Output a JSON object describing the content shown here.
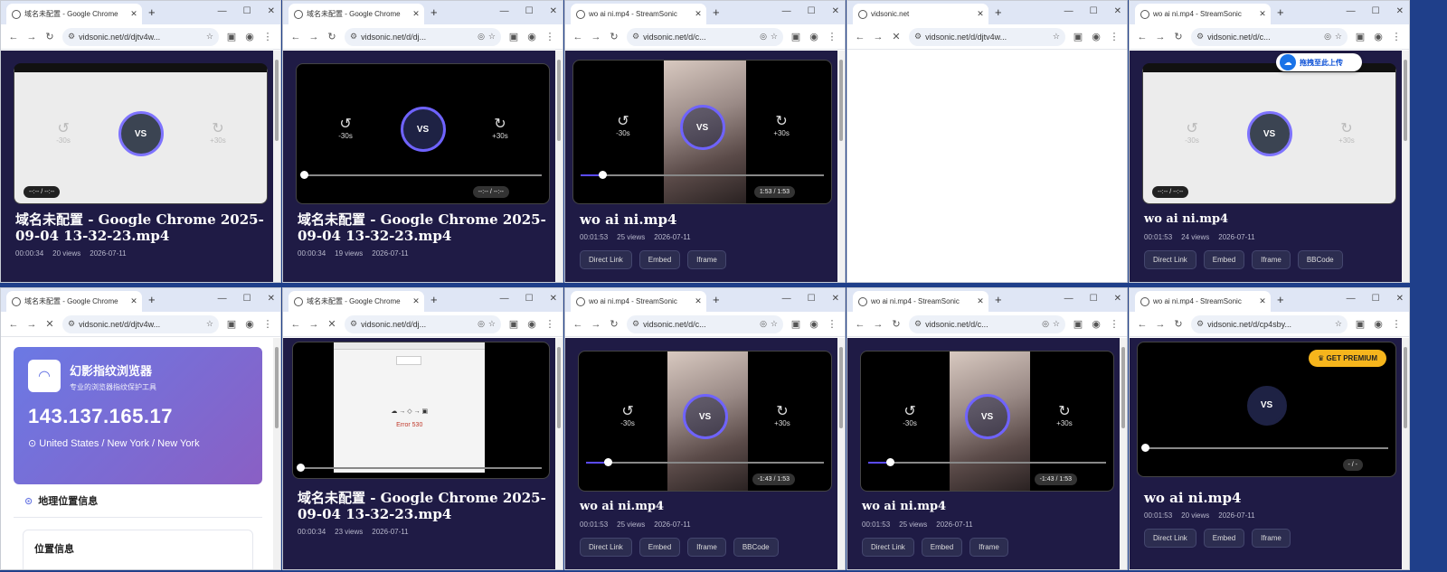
{
  "windows": [
    {
      "tab_title": "域名未配置 - Google Chrome",
      "url": "vidsonic.net/d/djtv4w...",
      "video_title": "域名未配置 - Google Chrome 2025-09-04 13-32-23.mp4",
      "duration": "00:00:34",
      "views": "20 views",
      "date": "2026-07-11",
      "time_text": "--:-- / --:--",
      "skip_back": "-30s",
      "skip_fwd": "+30s",
      "play_label": "VS"
    },
    {
      "tab_title": "域名未配置 - Google Chrome",
      "url": "vidsonic.net/d/dj...",
      "video_title": "域名未配置 - Google Chrome 2025-09-04 13-32-23.mp4",
      "duration": "00:00:34",
      "views": "19 views",
      "date": "2026-07-11",
      "time_text": "--:-- / --:--",
      "skip_back": "-30s",
      "skip_fwd": "+30s",
      "play_label": "VS"
    },
    {
      "tab_title": "wo ai ni.mp4 - StreamSonic",
      "url": "vidsonic.net/d/c...",
      "video_title": "wo ai ni.mp4",
      "duration": "00:01:53",
      "views": "25 views",
      "date": "2026-07-11",
      "time_text": "1:53 / 1:53",
      "skip_back": "-30s",
      "skip_fwd": "+30s",
      "play_label": "VS",
      "buttons": [
        "Direct Link",
        "Embed",
        "Iframe"
      ]
    },
    {
      "tab_title": "vidsonic.net",
      "url": "vidsonic.net/d/djtv4w..."
    },
    {
      "tab_title": "wo ai ni.mp4 - StreamSonic",
      "url": "vidsonic.net/d/c...",
      "video_title": "wo ai ni.mp4",
      "duration": "00:01:53",
      "views": "24 views",
      "date": "2026-07-11",
      "time_text": "--:-- / --:--",
      "skip_back": "-30s",
      "skip_fwd": "+30s",
      "play_label": "VS",
      "buttons": [
        "Direct Link",
        "Embed",
        "Iframe",
        "BBCode"
      ],
      "upload_text": "拖拽至此上传"
    },
    {
      "tab_title": "域名未配置 - Google Chrome",
      "url": "vidsonic.net/d/djtv4w...",
      "fp_name": "幻影指纹浏览器",
      "fp_sub": "专业的浏览器指纹保护工具",
      "fp_ip": "143.137.165.17",
      "fp_loc": "United States / New York / New York",
      "fp_section": "地理位置信息",
      "fp_box": "位置信息"
    },
    {
      "tab_title": "域名未配置 - Google Chrome",
      "url": "vidsonic.net/d/dj...",
      "video_title": "域名未配置 - Google Chrome 2025-09-04 13-32-23.mp4",
      "duration": "00:00:34",
      "views": "23 views",
      "date": "2026-07-11",
      "error_text": "Error 530"
    },
    {
      "tab_title": "wo ai ni.mp4 - StreamSonic",
      "url": "vidsonic.net/d/c...",
      "video_title": "wo ai ni.mp4",
      "duration": "00:01:53",
      "views": "25 views",
      "date": "2026-07-11",
      "time_text": "-1:43 / 1:53",
      "skip_back": "-30s",
      "skip_fwd": "+30s",
      "play_label": "VS",
      "buttons": [
        "Direct Link",
        "Embed",
        "Iframe",
        "BBCode"
      ]
    },
    {
      "tab_title": "wo ai ni.mp4 - StreamSonic",
      "url": "vidsonic.net/d/c...",
      "video_title": "wo ai ni.mp4",
      "duration": "00:01:53",
      "views": "25 views",
      "date": "2026-07-11",
      "time_text": "-1:43 / 1:53",
      "skip_back": "-30s",
      "skip_fwd": "+30s",
      "play_label": "VS",
      "buttons": [
        "Direct Link",
        "Embed",
        "Iframe"
      ]
    },
    {
      "tab_title": "wo ai ni.mp4 - StreamSonic",
      "url": "vidsonic.net/d/cp4sby...",
      "video_title": "wo ai ni.mp4",
      "duration": "00:01:53",
      "views": "20 views",
      "date": "2026-07-11",
      "time_text": "- / -",
      "play_label": "VS",
      "premium": "GET PREMIUM",
      "buttons": [
        "Direct Link",
        "Embed",
        "Iframe"
      ]
    }
  ],
  "progress": [
    0.0,
    0.0,
    0.09,
    null,
    0.0,
    null,
    0.0,
    0.09,
    0.09,
    0.0
  ]
}
